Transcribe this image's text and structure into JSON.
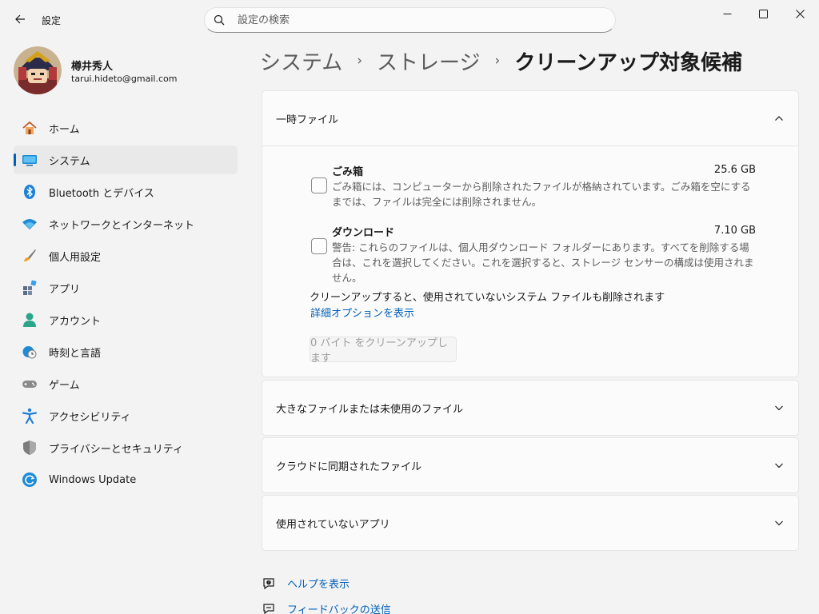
{
  "window": {
    "title": "設定",
    "minimize_icon": "minimize-icon",
    "maximize_icon": "maximize-icon",
    "close_icon": "close-icon"
  },
  "search": {
    "placeholder": "設定の検索"
  },
  "user": {
    "name": "樽井秀人",
    "email": "tarui.hideto@gmail.com"
  },
  "sidebar": {
    "items": [
      {
        "label": "ホーム",
        "icon": "home-icon"
      },
      {
        "label": "システム",
        "icon": "system-icon",
        "active": true
      },
      {
        "label": "Bluetooth とデバイス",
        "icon": "bluetooth-icon"
      },
      {
        "label": "ネットワークとインターネット",
        "icon": "wifi-icon"
      },
      {
        "label": "個人用設定",
        "icon": "brush-icon"
      },
      {
        "label": "アプリ",
        "icon": "apps-icon"
      },
      {
        "label": "アカウント",
        "icon": "account-icon"
      },
      {
        "label": "時刻と言語",
        "icon": "time-language-icon"
      },
      {
        "label": "ゲーム",
        "icon": "gamepad-icon"
      },
      {
        "label": "アクセシビリティ",
        "icon": "accessibility-icon"
      },
      {
        "label": "プライバシーとセキュリティ",
        "icon": "shield-icon"
      },
      {
        "label": "Windows Update",
        "icon": "update-icon"
      }
    ]
  },
  "breadcrumb": {
    "items": [
      "システム",
      "ストレージ"
    ],
    "current": "クリーンアップ対象候補",
    "separator": "›"
  },
  "sections": {
    "temp": {
      "title": "一時ファイル",
      "expanded": true,
      "items": [
        {
          "name": "ごみ箱",
          "size": "25.6 GB",
          "description": "ごみ箱には、コンピューターから削除されたファイルが格納されています。ごみ箱を空にするまでは、ファイルは完全には削除されません。",
          "checked": false
        },
        {
          "name": "ダウンロード",
          "size": "7.10 GB",
          "description": "警告: これらのファイルは、個人用ダウンロード フォルダーにあります。すべてを削除する場合は、これを選択してください。これを選択すると、ストレージ センサーの構成は使用されません。",
          "checked": false
        }
      ],
      "note": "クリーンアップすると、使用されていないシステム ファイルも削除されます",
      "advanced_link": "詳細オプションを表示",
      "cleanup_button": "0 バイト をクリーンアップします"
    },
    "large": {
      "title": "大きなファイルまたは未使用のファイル"
    },
    "cloud": {
      "title": "クラウドに同期されたファイル"
    },
    "unused_apps": {
      "title": "使用されていないアプリ"
    }
  },
  "footer": {
    "help": "ヘルプを表示",
    "feedback": "フィードバックの送信"
  },
  "colors": {
    "accent": "#005fb8",
    "background": "#f3f3f3",
    "card": "#fbfbfb"
  }
}
